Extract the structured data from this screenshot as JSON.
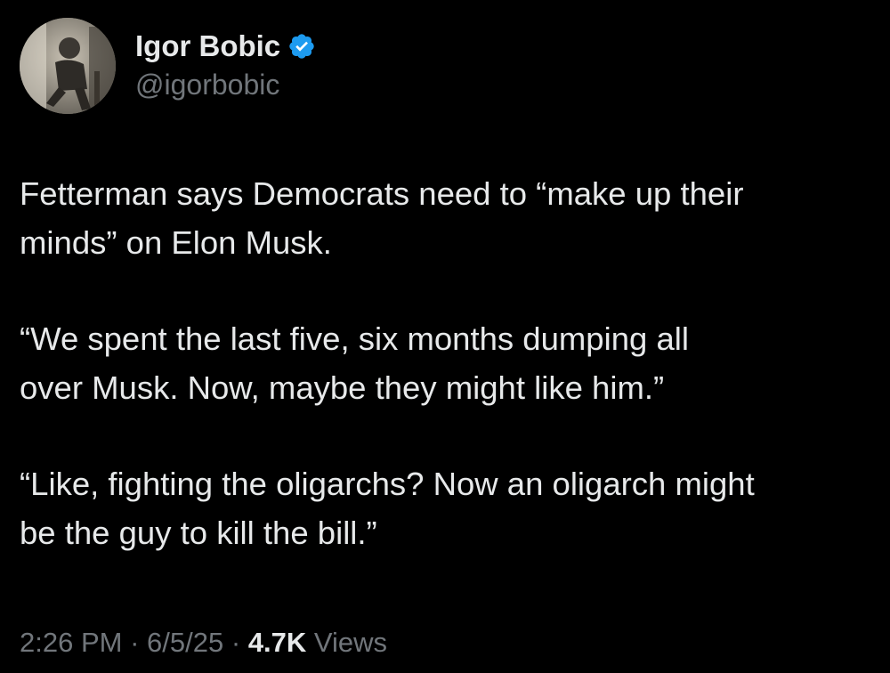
{
  "author": {
    "display_name": "Igor Bobic",
    "handle": "@igorbobic",
    "verified": true,
    "verified_color": "#1d9bf0"
  },
  "tweet": {
    "paragraphs": [
      "Fetterman says Democrats need to “make up their\nminds” on Elon Musk.",
      "“We spent the last five, six months dumping all\nover Musk. Now, maybe they might like him.”",
      "“Like, fighting the oligarchs? Now an oligarch might\nbe the guy to kill the bill.”"
    ]
  },
  "meta": {
    "time": "2:26 PM",
    "separator": "·",
    "date": "6/5/25",
    "views_count": "4.7K",
    "views_label": "Views"
  },
  "colors": {
    "background": "#000000",
    "text_primary": "#e7e9ea",
    "text_secondary": "#71767b"
  },
  "icons": {
    "verified": "verified-badge-icon"
  }
}
